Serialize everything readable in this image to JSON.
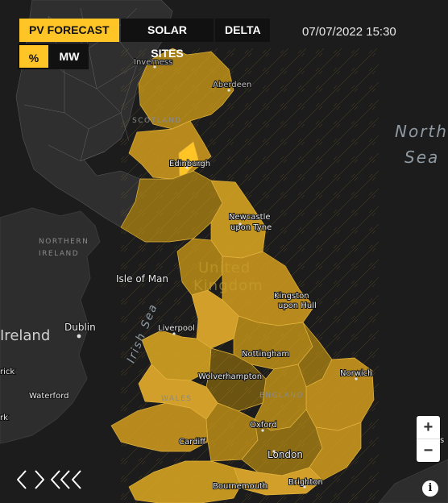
{
  "tabs": [
    {
      "label": "PV FORECAST",
      "active": true
    },
    {
      "label": "SOLAR SITES",
      "active": false
    },
    {
      "label": "DELTA",
      "active": false
    }
  ],
  "units": [
    {
      "label": "%",
      "active": true
    },
    {
      "label": "MW",
      "active": false
    }
  ],
  "datetime": "07/07/2022 15:30",
  "zoom": {
    "in_label": "+",
    "out_label": "−"
  },
  "attribution_label": "i",
  "map_labels": {
    "inverness": "Inverness",
    "aberdeen": "Aberdeen",
    "scotland": "SCOTLAND",
    "edinburgh": "Edinburgh",
    "newcastle_1": "Newcastle",
    "newcastle_2": "upon Tyne",
    "northern_ireland_1": "NORTHERN",
    "northern_ireland_2": "IRELAND",
    "isle_of_man": "Isle of Man",
    "united_1": "United",
    "united_2": "Kingdom",
    "ireland": "Ireland",
    "dublin": "Dublin",
    "irish_sea": "Irish Sea",
    "liverpool": "Liverpool",
    "kingston_1": "Kingston",
    "kingston_2": "upon Hull",
    "nottingham": "Nottingham",
    "wolverhampton": "Wolverhampton",
    "norwich": "Norwich",
    "waterford": "Waterford",
    "wales": "WALES",
    "england": "ENGLAND",
    "oxford": "Oxford",
    "cardiff": "Cardiff",
    "london": "London",
    "bournemouth": "Bournemouth",
    "brighton": "Brighton",
    "north_sea_1": "North",
    "north_sea_2": "Sea",
    "rick": "rick",
    "rk": "rk",
    "s": "s"
  },
  "colors": {
    "accent": "#ffc425",
    "land": "#2b2b2b",
    "sea": "#1c1c1c",
    "region_fill": "#a77f18",
    "region_bright": "#d8a629",
    "region_dark": "#6b5412",
    "region_stroke": "#e2b43d"
  }
}
